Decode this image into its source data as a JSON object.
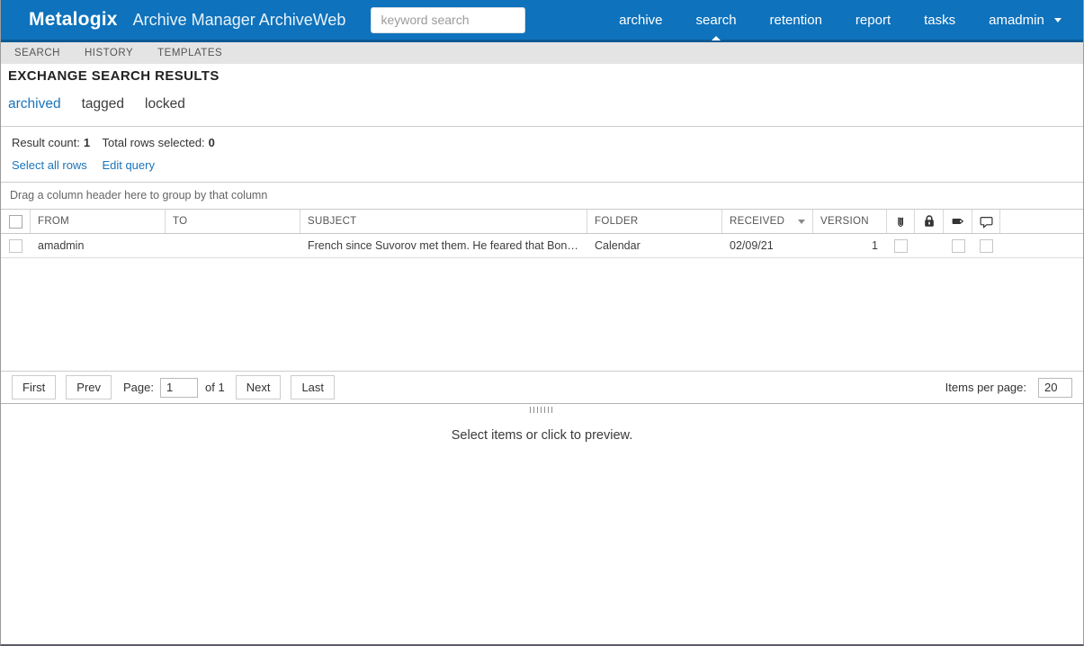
{
  "header": {
    "logo": "Metalogix",
    "app_title": "Archive Manager ArchiveWeb",
    "search_placeholder": "keyword search",
    "nav": [
      {
        "label": "archive",
        "active": false
      },
      {
        "label": "search",
        "active": true
      },
      {
        "label": "retention",
        "active": false
      },
      {
        "label": "report",
        "active": false
      },
      {
        "label": "tasks",
        "active": false
      }
    ],
    "user_menu": {
      "label": "amadmin"
    }
  },
  "subnav": {
    "items": [
      {
        "label": "SEARCH"
      },
      {
        "label": "HISTORY"
      },
      {
        "label": "TEMPLATES"
      }
    ]
  },
  "page": {
    "title": "EXCHANGE SEARCH RESULTS",
    "tabs": [
      {
        "label": "archived",
        "active": true
      },
      {
        "label": "tagged",
        "active": false
      },
      {
        "label": "locked",
        "active": false
      }
    ]
  },
  "results": {
    "result_count_label": "Result count:",
    "result_count": "1",
    "rows_selected_label": "Total rows selected:",
    "rows_selected": "0",
    "select_all_link": "Select all rows",
    "edit_query_link": "Edit query",
    "group_hint": "Drag a column header here to group by that column"
  },
  "table": {
    "columns": {
      "from": "FROM",
      "to": "TO",
      "subject": "SUBJECT",
      "folder": "FOLDER",
      "received": "RECEIVED",
      "version": "VERSION"
    },
    "icon_columns": [
      "paperclip-icon",
      "lock-icon",
      "tag-icon",
      "comment-icon"
    ],
    "rows": [
      {
        "from": "amadmin",
        "to": "",
        "subject": "French since Suvorov met them. He feared that Bonapart...",
        "folder": "Calendar",
        "received": "02/09/21",
        "version": "1",
        "attachment_checkbox": true,
        "lock_checkbox": false,
        "tag_checkbox": true,
        "comment_checkbox": true
      }
    ]
  },
  "pagination": {
    "first_label": "First",
    "prev_label": "Prev",
    "page_label": "Page:",
    "page_value": "1",
    "of_label": "of",
    "total_pages": "1",
    "next_label": "Next",
    "last_label": "Last",
    "items_per_page_label": "Items per page:",
    "items_per_page_value": "20"
  },
  "preview": {
    "message": "Select items or click to preview."
  },
  "colors": {
    "header_bg": "#0e72bc",
    "header_accent": "#0b5a94",
    "subnav_bg": "#e4e4e4",
    "link_blue": "#1b74bb"
  }
}
